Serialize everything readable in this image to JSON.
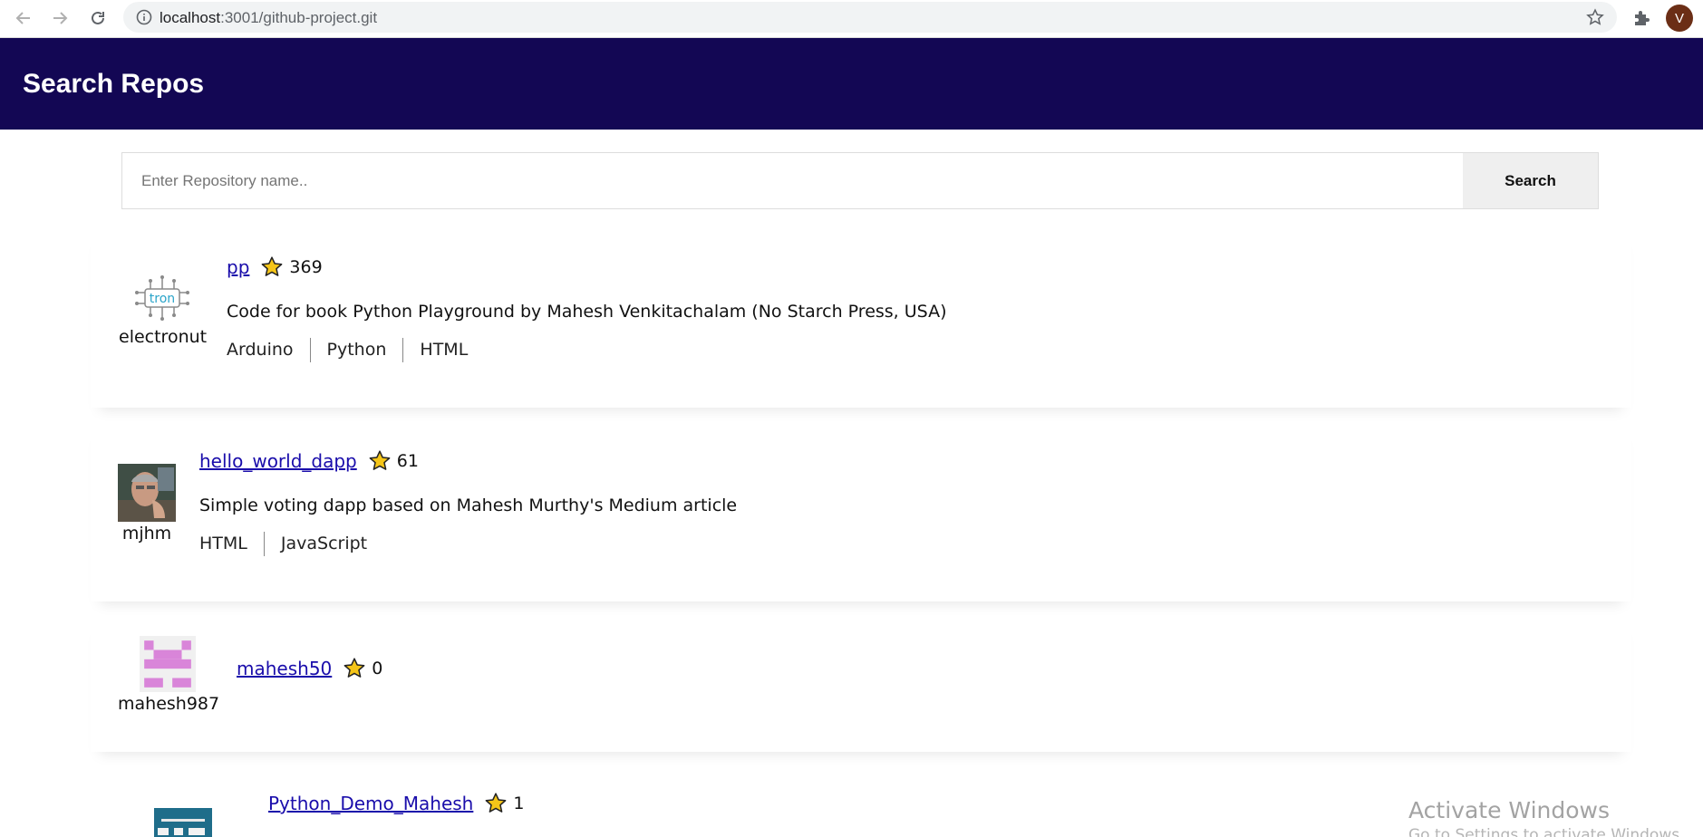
{
  "browser": {
    "url_host": "localhost",
    "url_path": ":3001/github-project.git",
    "profile_initial": "V"
  },
  "header": {
    "title": "Search Repos"
  },
  "search": {
    "placeholder": "Enter Repository name..",
    "button_label": "Search"
  },
  "repos": [
    {
      "owner": "electronut",
      "name": "pp",
      "stars": "369",
      "description": "Code for book Python Playground by Mahesh Venkitachalam (No Starch Press, USA)",
      "languages": [
        "Arduino",
        "Python",
        "HTML"
      ]
    },
    {
      "owner": "mjhm",
      "name": "hello_world_dapp",
      "stars": "61",
      "description": "Simple voting dapp based on Mahesh Murthy's Medium article",
      "languages": [
        "HTML",
        "JavaScript"
      ]
    },
    {
      "owner": "mahesh987",
      "name": "mahesh50",
      "stars": "0",
      "description": "",
      "languages": []
    },
    {
      "owner": "",
      "name": "Python_Demo_Mahesh",
      "stars": "1",
      "description": "",
      "languages": []
    }
  ],
  "os_watermark": {
    "title": "Activate Windows",
    "subtitle": "Go to Settings to activate Windows."
  },
  "colors": {
    "header_bg": "#130754",
    "link": "#1a0dab",
    "star_fill": "#f5c518"
  },
  "icons": {
    "back": "arrow-left-icon",
    "forward": "arrow-right-icon",
    "reload": "reload-icon",
    "info": "info-icon",
    "bookmark": "star-outline-icon",
    "extensions": "puzzle-icon",
    "repo_star": "star-icon"
  }
}
